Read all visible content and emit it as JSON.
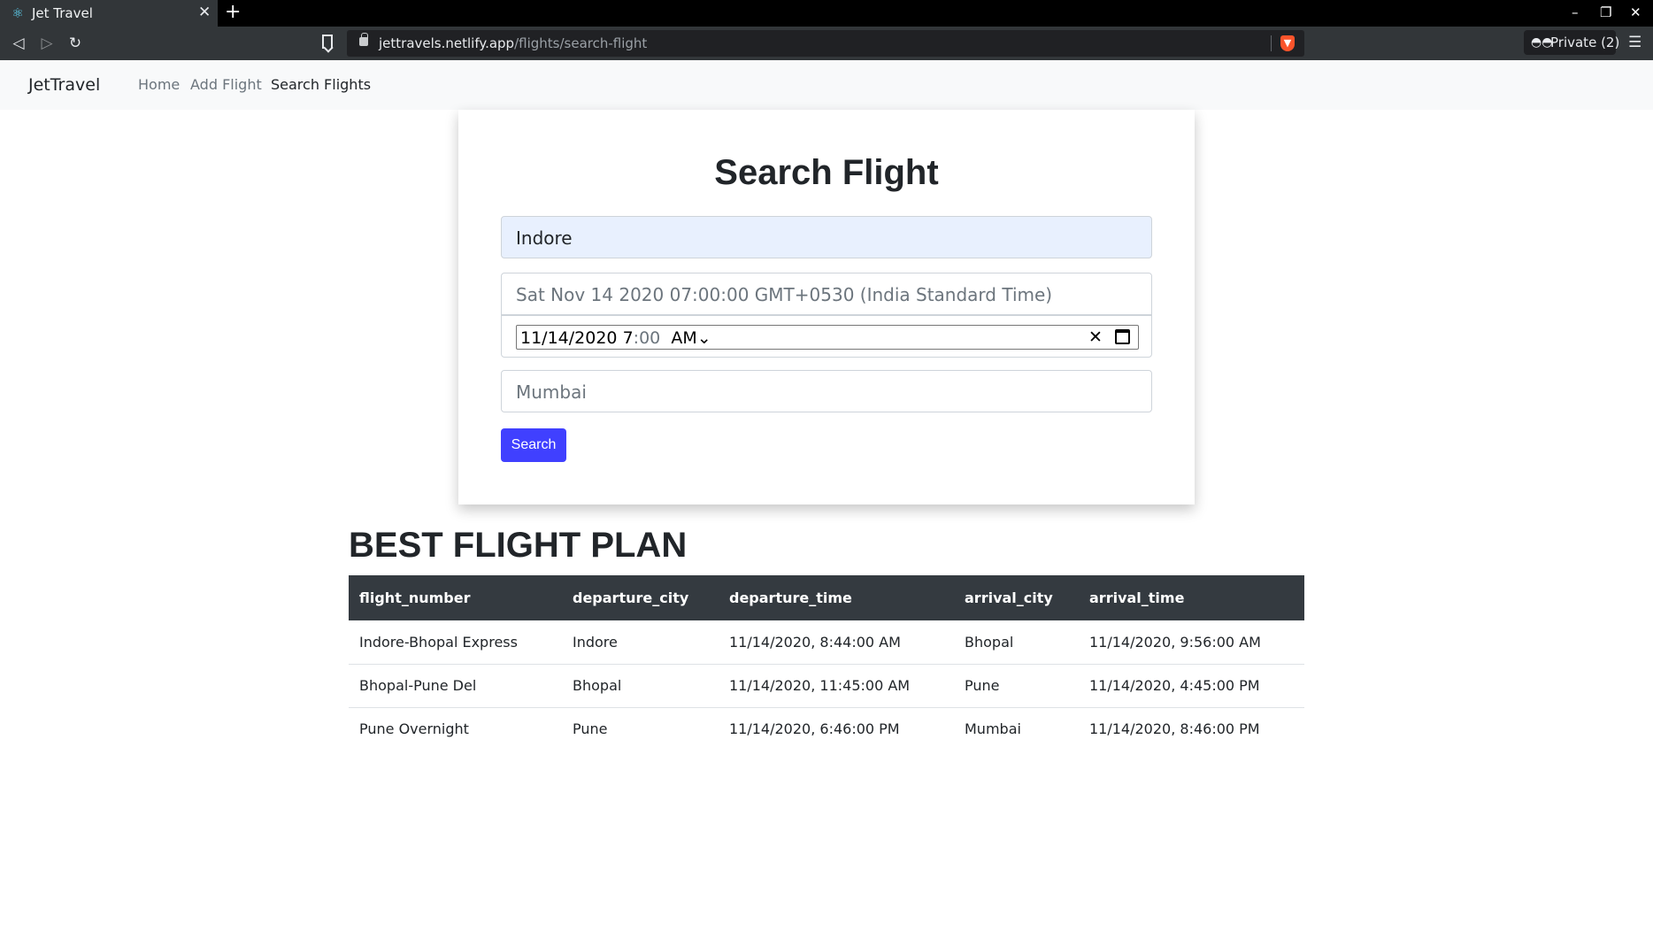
{
  "browser": {
    "tab_title": "Jet Travel",
    "url_host": "jettravels.netlify.app",
    "url_path": "/flights/search-flight",
    "private_label": "Private (2)",
    "icons": {
      "tab": "react-logo-icon",
      "close": "close-icon",
      "new_tab": "plus-icon",
      "back": "back-arrow-icon",
      "forward": "forward-arrow-icon",
      "reload": "reload-icon",
      "bookmark": "bookmark-icon",
      "lock": "lock-icon",
      "brave": "brave-shield-icon",
      "private": "private-glasses-icon",
      "menu": "hamburger-menu-icon"
    }
  },
  "navbar": {
    "brand": "JetTravel",
    "links": [
      {
        "label": "Home",
        "active": false
      },
      {
        "label": "Add Flight",
        "active": false
      },
      {
        "label": "Search Flights",
        "active": true
      }
    ]
  },
  "search_form": {
    "title": "Search Flight",
    "from_value": "Indore",
    "date_display": "Sat Nov 14 2020 07:00:00 GMT+0530 (India Standard Time)",
    "datetime": {
      "date": "11/14/2020",
      "hour": "7",
      "sep": ":",
      "minute": "00",
      "ampm": "AM",
      "caret": "⌄",
      "clear_glyph": "✕"
    },
    "to_value": "Mumbai",
    "search_label": "Search",
    "accent_color": "#4040ff"
  },
  "results": {
    "title": "BEST FLIGHT PLAN",
    "columns": [
      "flight_number",
      "departure_city",
      "departure_time",
      "arrival_city",
      "arrival_time"
    ],
    "rows": [
      [
        "Indore-Bhopal Express",
        "Indore",
        "11/14/2020, 8:44:00 AM",
        "Bhopal",
        "11/14/2020, 9:56:00 AM"
      ],
      [
        "Bhopal-Pune Del",
        "Bhopal",
        "11/14/2020, 11:45:00 AM",
        "Pune",
        "11/14/2020, 4:45:00 PM"
      ],
      [
        "Pune Overnight",
        "Pune",
        "11/14/2020, 6:46:00 PM",
        "Mumbai",
        "11/14/2020, 8:46:00 PM"
      ]
    ],
    "header_color": "#343a40"
  }
}
